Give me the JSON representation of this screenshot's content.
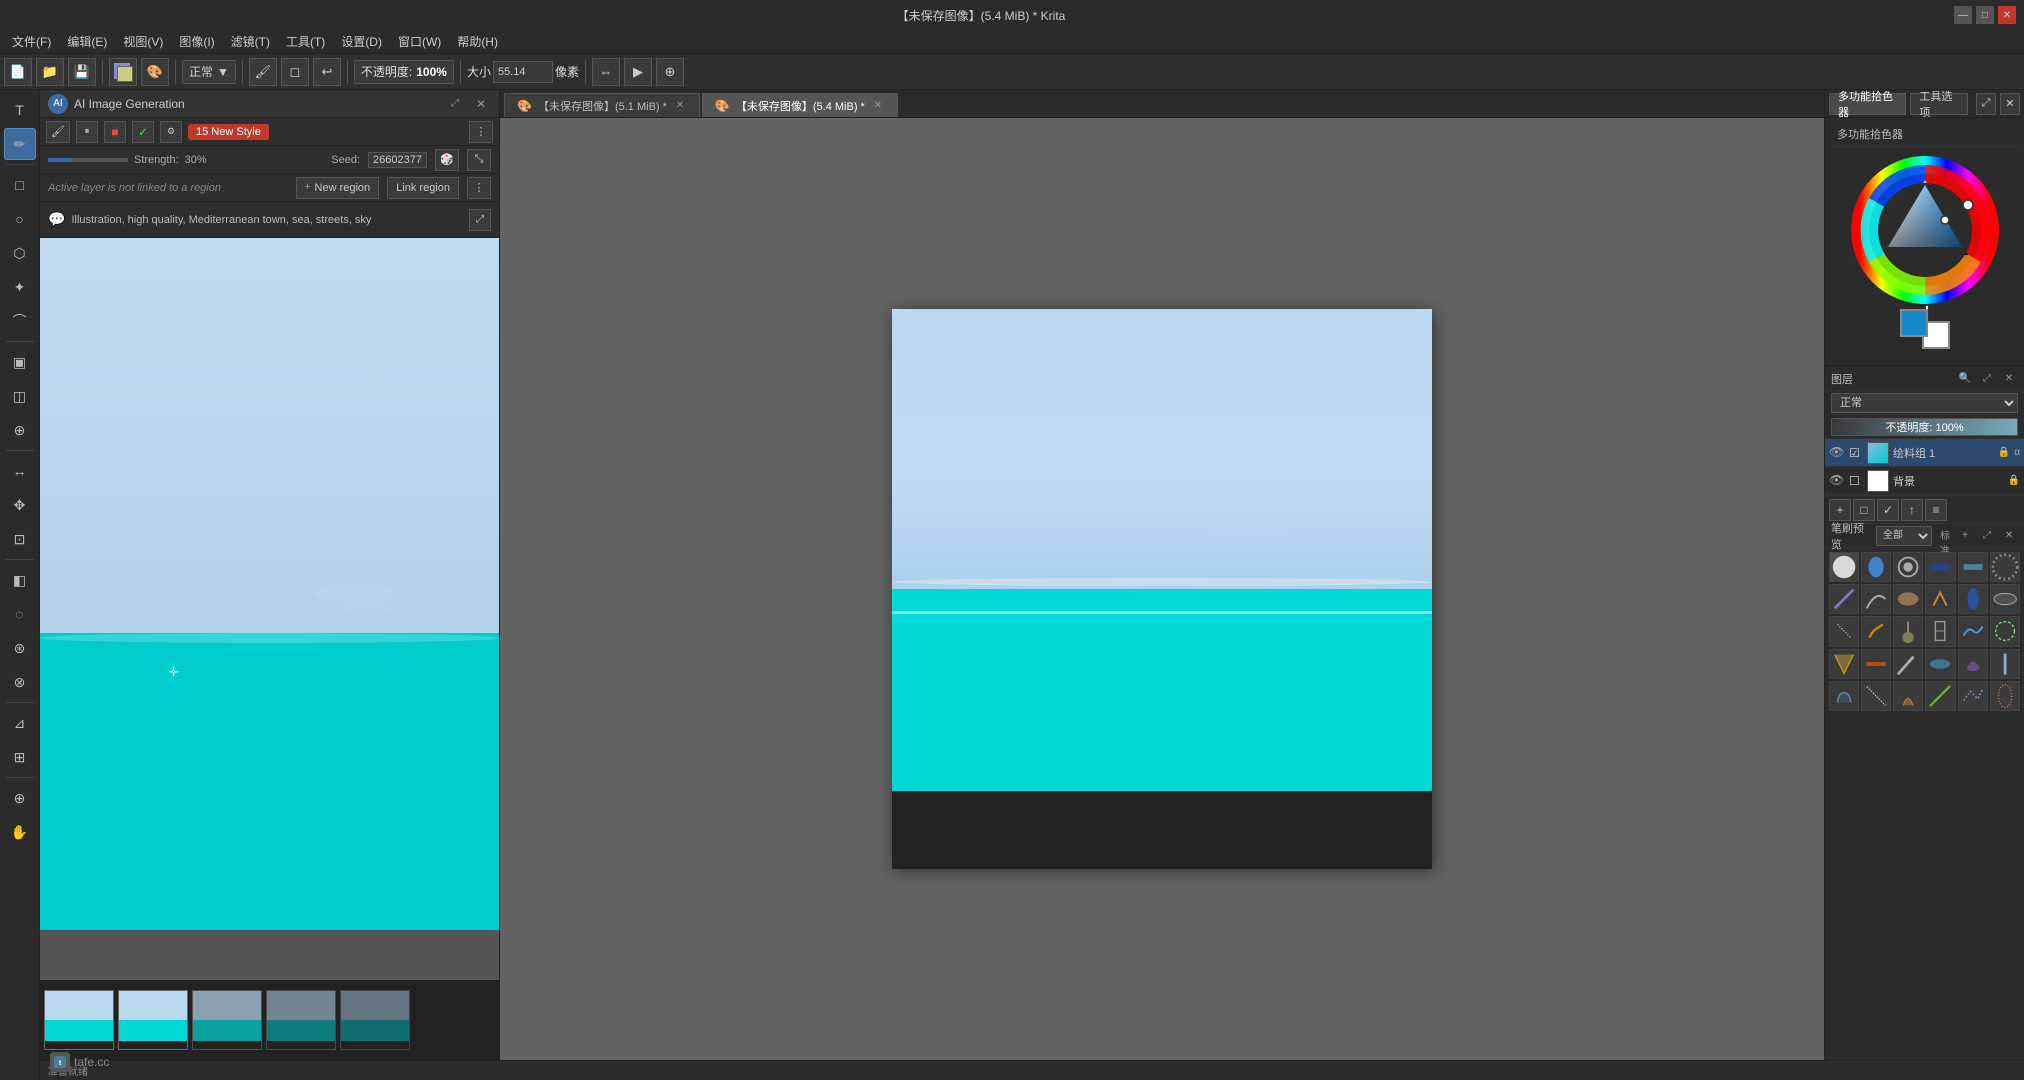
{
  "app": {
    "title": "【未保存图像】(5.4 MiB) * Krita",
    "title_bar_label": "【未保存图像】(5.4 MiB) * Krita"
  },
  "menu": {
    "items": [
      "文件(F)",
      "编辑(E)",
      "视图(V)",
      "图像(I)",
      "滤镜(T)",
      "工具(T)",
      "设置(D)",
      "窗口(W)",
      "帮助(H)"
    ]
  },
  "toolbar": {
    "blend_mode": "正常",
    "opacity_label": "不透明度:",
    "opacity_value": "100%",
    "size_label": "大小",
    "size_value": "55.14",
    "size_unit": "像素"
  },
  "ai_panel": {
    "title": "AI Image Generation",
    "strength_label": "Strength:",
    "strength_value": "30%",
    "seed_label": "Seed:",
    "seed_value": "26602377",
    "region_status": "Active layer is not linked to a region",
    "new_region_btn": "+ New region",
    "link_region_btn": "Link region",
    "prompt_text": "Illustration, high quality, Mediterranean town, sea, streets, sky",
    "new_style_label": "🎨 New Style",
    "style_count": "15 New Style",
    "stop_btn": "■",
    "check_btn": "✓"
  },
  "canvas_tabs": [
    {
      "id": "tab1",
      "icon": "🎨",
      "label": "【未保存图像】(5.1 MiB) *",
      "active": false
    },
    {
      "id": "tab2",
      "icon": "🎨",
      "label": "【未保存图像】(5.4 MiB) *",
      "active": true
    }
  ],
  "right_panel": {
    "tabs": [
      "多功能拾色器",
      "工具选项"
    ],
    "active_tab": "多功能拾色器",
    "color_panel_title": "多功能拾色器",
    "blend_mode": "正常",
    "opacity_label": "不透明度:",
    "opacity_value": "100%"
  },
  "layers": {
    "section_title": "图层",
    "blend_mode": "正常",
    "opacity_display": "不透明度: 100%",
    "items": [
      {
        "name": "绘料组 1",
        "visible": true,
        "active": true,
        "locked": false
      },
      {
        "name": "背景",
        "visible": true,
        "active": false,
        "locked": true
      }
    ],
    "toolbar_buttons": [
      "+",
      "□",
      "✓",
      "↑",
      "≡"
    ]
  },
  "brush_presets": {
    "section_title": "笔刷预览",
    "filter_label": "全部",
    "view_options": [
      "标准",
      "+"
    ],
    "presets": [
      "basic_1",
      "basic_2",
      "basic_3",
      "basic_4",
      "basic_5",
      "basic_6",
      "pen_1",
      "pen_2",
      "pen_3",
      "pen_4",
      "pen_5",
      "pen_6",
      "pencil_1",
      "pencil_2",
      "pencil_3",
      "pencil_4",
      "pencil_5",
      "pencil_6",
      "marker_1",
      "marker_2",
      "marker_3",
      "marker_4",
      "marker_5",
      "marker_6",
      "ink_1",
      "ink_2",
      "ink_3",
      "ink_4",
      "ink_5",
      "ink_6"
    ]
  },
  "left_tools": [
    {
      "id": "text",
      "icon": "T",
      "tooltip": "Text Tool"
    },
    {
      "id": "paint",
      "icon": "✏",
      "tooltip": "Freehand Brush Tool",
      "active": true
    },
    {
      "id": "eraser",
      "icon": "◻",
      "tooltip": "Eraser"
    },
    {
      "id": "fill",
      "icon": "▣",
      "tooltip": "Fill Tool"
    },
    {
      "id": "colorpick",
      "icon": "⊕",
      "tooltip": "Color Picker"
    },
    {
      "id": "rect",
      "icon": "□",
      "tooltip": "Rectangle Tool"
    },
    {
      "id": "ellipse",
      "icon": "○",
      "tooltip": "Ellipse Tool"
    },
    {
      "id": "path",
      "icon": "✦",
      "tooltip": "Path Tool"
    },
    {
      "id": "transform",
      "icon": "↔",
      "tooltip": "Transform Tool"
    },
    {
      "id": "crop",
      "icon": "⊡",
      "tooltip": "Crop Tool"
    },
    {
      "id": "lasso",
      "icon": "⌒",
      "tooltip": "Freehand Selection"
    },
    {
      "id": "magic",
      "icon": "⊛",
      "tooltip": "Magic Wand"
    },
    {
      "id": "move",
      "icon": "✥",
      "tooltip": "Move Tool"
    },
    {
      "id": "measure",
      "icon": "⊿",
      "tooltip": "Measure Tool"
    },
    {
      "id": "guides",
      "icon": "⊞",
      "tooltip": "Guides"
    },
    {
      "id": "contiguous",
      "icon": "◈",
      "tooltip": "Contiguous Selection"
    },
    {
      "id": "similar",
      "icon": "⊗",
      "tooltip": "Similar Selection"
    },
    {
      "id": "zoom",
      "icon": "⊕",
      "tooltip": "Zoom Tool"
    },
    {
      "id": "hand",
      "icon": "✋",
      "tooltip": "Pan Tool"
    }
  ],
  "watermark": {
    "text": "tafe.cc"
  },
  "colors": {
    "accent_blue": "#3d6b9e",
    "sky_light": "#b8d8f0",
    "sea_cyan": "#00d8d8",
    "ground_dark": "#222222",
    "bg_panel": "#2b2b2b",
    "bg_canvas": "#636363",
    "new_style_red": "#c0392b"
  }
}
